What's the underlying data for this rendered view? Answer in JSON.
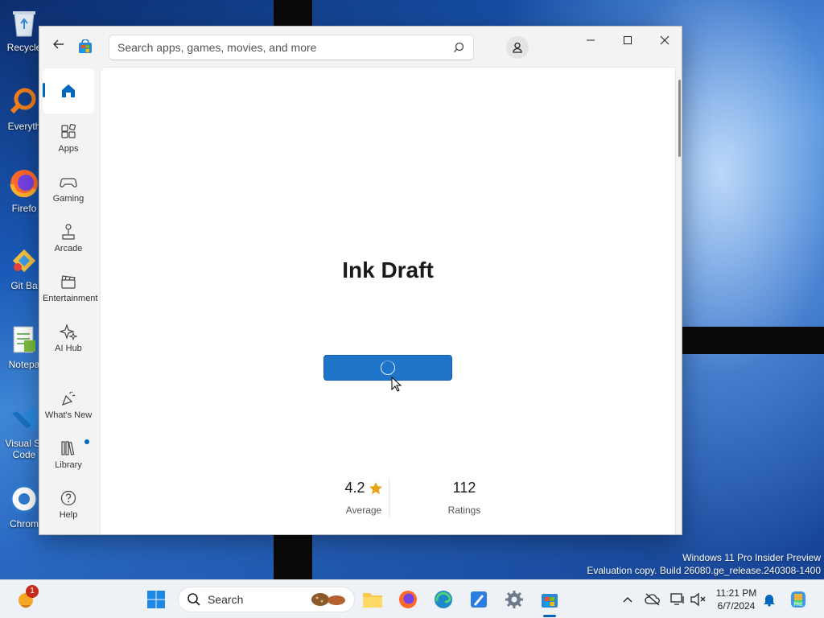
{
  "desktop": {
    "icons": [
      {
        "label": "Recycle",
        "icon": "recycle-bin-icon"
      },
      {
        "label": "Everyth",
        "icon": "everything-search-icon"
      },
      {
        "label": "Firefo",
        "icon": "firefox-icon"
      },
      {
        "label": "Git Ba",
        "icon": "git-bash-icon"
      },
      {
        "label": "Notepa",
        "icon": "notepad-icon"
      },
      {
        "label": "Visual St\nCode",
        "icon": "vscode-icon"
      },
      {
        "label": "Chrom",
        "icon": "chrome-icon"
      }
    ],
    "watermark_line1": "Windows 11 Pro Insider Preview",
    "watermark_line2": "Evaluation copy. Build 26080.ge_release.240308-1400"
  },
  "store": {
    "search_placeholder": "Search apps, games, movies, and more",
    "nav": [
      {
        "label": "Apps",
        "icon": "apps-icon"
      },
      {
        "label": "Gaming",
        "icon": "gamepad-icon"
      },
      {
        "label": "Arcade",
        "icon": "joystick-icon"
      },
      {
        "label": "Entertainment",
        "icon": "clapperboard-icon"
      },
      {
        "label": "AI Hub",
        "icon": "sparkle-icon"
      },
      {
        "label": "What's New",
        "icon": "party-popper-icon"
      },
      {
        "label": "Library",
        "icon": "library-icon"
      },
      {
        "label": "Help",
        "icon": "help-icon"
      }
    ],
    "app": {
      "title": "Ink Draft",
      "rating": "4.2",
      "rating_label": "Average",
      "ratings_count": "112",
      "ratings_count_label": "Ratings"
    }
  },
  "taskbar": {
    "search_label": "Search",
    "weather_badge": "1",
    "time": "11:21 PM",
    "date": "6/7/2024"
  },
  "colors": {
    "accent": "#0067c0",
    "install_button": "#1e74c8",
    "star": "#e8a317"
  }
}
